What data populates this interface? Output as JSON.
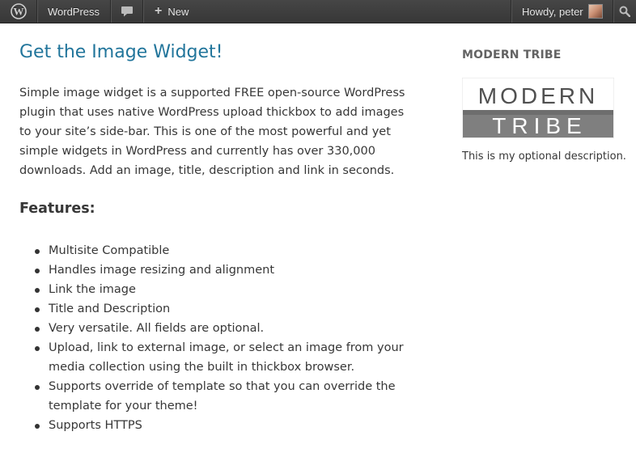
{
  "adminbar": {
    "site_name": "WordPress",
    "new_label": "New",
    "howdy": "Howdy, peter",
    "icons": [
      "wordpress-icon",
      "comment-icon",
      "plus-icon",
      "avatar",
      "search-icon"
    ]
  },
  "content": {
    "title": "Get the Image Widget!",
    "intro": "Simple image widget is a supported FREE open-source WordPress plugin that uses native WordPress upload thickbox to add images to your site’s side-bar. This is one of the most powerful and yet simple widgets in WordPress and currently has over 330,000 downloads. Add an image, title, description and link in seconds.",
    "features_heading": "Features:",
    "features": [
      "Multisite Compatible",
      "Handles image resizing and alignment",
      "Link the image",
      "Title and Description",
      "Very versatile. All fields are optional.",
      "Upload, link to external image, or select an image from your media collection using the built in thickbox browser.",
      "Supports override of template so that you can override the template for your theme!",
      "Supports HTTPS"
    ]
  },
  "sidebar": {
    "widget_title": "MODERN TRIBE",
    "logo_top": "MODERN",
    "logo_bottom": "TRIBE",
    "description": "This is my optional description.",
    "colors": {
      "logo_band": "#7f7f7f",
      "link": "#21759b"
    }
  }
}
